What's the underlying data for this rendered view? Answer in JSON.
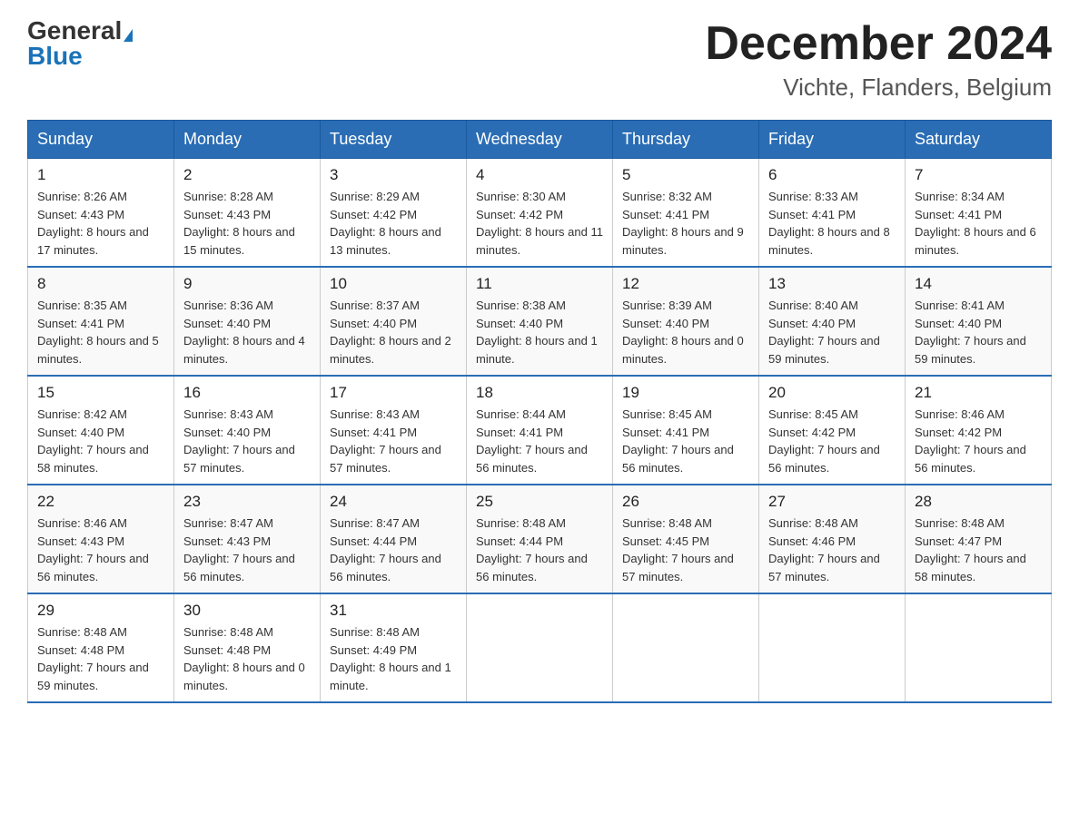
{
  "header": {
    "logo_general": "General",
    "logo_blue": "Blue",
    "month_title": "December 2024",
    "location": "Vichte, Flanders, Belgium"
  },
  "days_of_week": [
    "Sunday",
    "Monday",
    "Tuesday",
    "Wednesday",
    "Thursday",
    "Friday",
    "Saturday"
  ],
  "weeks": [
    [
      {
        "day": "1",
        "sunrise": "8:26 AM",
        "sunset": "4:43 PM",
        "daylight": "8 hours and 17 minutes."
      },
      {
        "day": "2",
        "sunrise": "8:28 AM",
        "sunset": "4:43 PM",
        "daylight": "8 hours and 15 minutes."
      },
      {
        "day": "3",
        "sunrise": "8:29 AM",
        "sunset": "4:42 PM",
        "daylight": "8 hours and 13 minutes."
      },
      {
        "day": "4",
        "sunrise": "8:30 AM",
        "sunset": "4:42 PM",
        "daylight": "8 hours and 11 minutes."
      },
      {
        "day": "5",
        "sunrise": "8:32 AM",
        "sunset": "4:41 PM",
        "daylight": "8 hours and 9 minutes."
      },
      {
        "day": "6",
        "sunrise": "8:33 AM",
        "sunset": "4:41 PM",
        "daylight": "8 hours and 8 minutes."
      },
      {
        "day": "7",
        "sunrise": "8:34 AM",
        "sunset": "4:41 PM",
        "daylight": "8 hours and 6 minutes."
      }
    ],
    [
      {
        "day": "8",
        "sunrise": "8:35 AM",
        "sunset": "4:41 PM",
        "daylight": "8 hours and 5 minutes."
      },
      {
        "day": "9",
        "sunrise": "8:36 AM",
        "sunset": "4:40 PM",
        "daylight": "8 hours and 4 minutes."
      },
      {
        "day": "10",
        "sunrise": "8:37 AM",
        "sunset": "4:40 PM",
        "daylight": "8 hours and 2 minutes."
      },
      {
        "day": "11",
        "sunrise": "8:38 AM",
        "sunset": "4:40 PM",
        "daylight": "8 hours and 1 minute."
      },
      {
        "day": "12",
        "sunrise": "8:39 AM",
        "sunset": "4:40 PM",
        "daylight": "8 hours and 0 minutes."
      },
      {
        "day": "13",
        "sunrise": "8:40 AM",
        "sunset": "4:40 PM",
        "daylight": "7 hours and 59 minutes."
      },
      {
        "day": "14",
        "sunrise": "8:41 AM",
        "sunset": "4:40 PM",
        "daylight": "7 hours and 59 minutes."
      }
    ],
    [
      {
        "day": "15",
        "sunrise": "8:42 AM",
        "sunset": "4:40 PM",
        "daylight": "7 hours and 58 minutes."
      },
      {
        "day": "16",
        "sunrise": "8:43 AM",
        "sunset": "4:40 PM",
        "daylight": "7 hours and 57 minutes."
      },
      {
        "day": "17",
        "sunrise": "8:43 AM",
        "sunset": "4:41 PM",
        "daylight": "7 hours and 57 minutes."
      },
      {
        "day": "18",
        "sunrise": "8:44 AM",
        "sunset": "4:41 PM",
        "daylight": "7 hours and 56 minutes."
      },
      {
        "day": "19",
        "sunrise": "8:45 AM",
        "sunset": "4:41 PM",
        "daylight": "7 hours and 56 minutes."
      },
      {
        "day": "20",
        "sunrise": "8:45 AM",
        "sunset": "4:42 PM",
        "daylight": "7 hours and 56 minutes."
      },
      {
        "day": "21",
        "sunrise": "8:46 AM",
        "sunset": "4:42 PM",
        "daylight": "7 hours and 56 minutes."
      }
    ],
    [
      {
        "day": "22",
        "sunrise": "8:46 AM",
        "sunset": "4:43 PM",
        "daylight": "7 hours and 56 minutes."
      },
      {
        "day": "23",
        "sunrise": "8:47 AM",
        "sunset": "4:43 PM",
        "daylight": "7 hours and 56 minutes."
      },
      {
        "day": "24",
        "sunrise": "8:47 AM",
        "sunset": "4:44 PM",
        "daylight": "7 hours and 56 minutes."
      },
      {
        "day": "25",
        "sunrise": "8:48 AM",
        "sunset": "4:44 PM",
        "daylight": "7 hours and 56 minutes."
      },
      {
        "day": "26",
        "sunrise": "8:48 AM",
        "sunset": "4:45 PM",
        "daylight": "7 hours and 57 minutes."
      },
      {
        "day": "27",
        "sunrise": "8:48 AM",
        "sunset": "4:46 PM",
        "daylight": "7 hours and 57 minutes."
      },
      {
        "day": "28",
        "sunrise": "8:48 AM",
        "sunset": "4:47 PM",
        "daylight": "7 hours and 58 minutes."
      }
    ],
    [
      {
        "day": "29",
        "sunrise": "8:48 AM",
        "sunset": "4:48 PM",
        "daylight": "7 hours and 59 minutes."
      },
      {
        "day": "30",
        "sunrise": "8:48 AM",
        "sunset": "4:48 PM",
        "daylight": "8 hours and 0 minutes."
      },
      {
        "day": "31",
        "sunrise": "8:48 AM",
        "sunset": "4:49 PM",
        "daylight": "8 hours and 1 minute."
      },
      null,
      null,
      null,
      null
    ]
  ],
  "labels": {
    "sunrise": "Sunrise:",
    "sunset": "Sunset:",
    "daylight": "Daylight:"
  }
}
